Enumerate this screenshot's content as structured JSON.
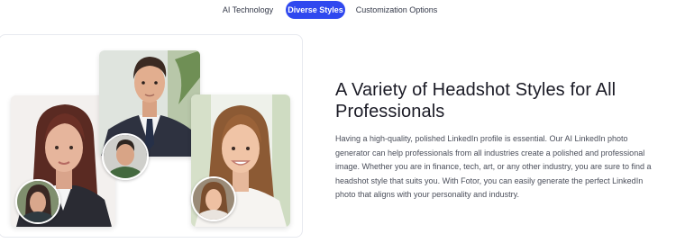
{
  "tabs": [
    {
      "label": "AI Technology",
      "active": false
    },
    {
      "label": "Diverse Styles",
      "active": true
    },
    {
      "label": "Customization Options",
      "active": false
    }
  ],
  "section": {
    "title": "A Variety of Headshot Styles for All Professionals",
    "description": "Having a high-quality, polished LinkedIn profile is essential. Our AI LinkedIn photo generator can help professionals from all industries create a polished and professional image. Whether you are in finance, tech, art, or any other industry, you are sure to find a headshot style that suits you. With Fotor, you can easily generate the perfect LinkedIn photo that aligns with your personality and industry."
  },
  "colors": {
    "accent": "#2f48ef",
    "heading": "#1b1b26",
    "body_text": "#4a4e5a"
  }
}
